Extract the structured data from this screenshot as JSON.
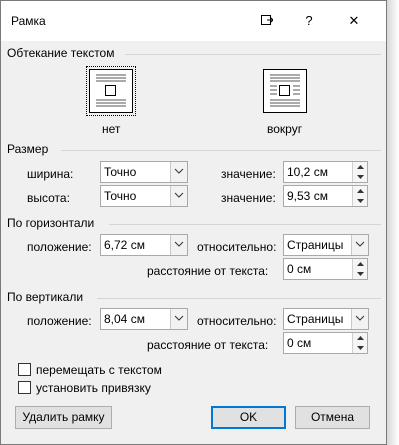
{
  "window": {
    "title": "Рамка",
    "help_glyph": "?",
    "close_glyph": "✕"
  },
  "wrap": {
    "heading": "Обтекание текстом",
    "none_label": "нет",
    "around_label": "вокруг"
  },
  "size": {
    "heading": "Размер",
    "width_label": "ширина:",
    "width_mode": "Точно",
    "width_value_label": "значение:",
    "width_value": "10,2 см",
    "height_label": "высота:",
    "height_mode": "Точно",
    "height_value_label": "значение:",
    "height_value": "9,53 см"
  },
  "horizontal": {
    "heading": "По горизонтали",
    "position_label": "положение:",
    "position_value": "6,72 см",
    "relative_label": "относительно:",
    "relative_value": "Страницы",
    "distance_label": "расстояние от текста:",
    "distance_value": "0 см"
  },
  "vertical": {
    "heading": "По вертикали",
    "position_label": "положение:",
    "position_value": "8,04 см",
    "relative_label": "относительно:",
    "relative_value": "Страницы",
    "distance_label": "расстояние от текста:",
    "distance_value": "0 см"
  },
  "options": {
    "move_with_text": "перемещать с текстом",
    "lock_anchor": "установить привязку"
  },
  "buttons": {
    "remove_frame": "Удалить рамку",
    "ok": "OK",
    "cancel": "Отмена"
  },
  "colors": {
    "accent": "#0078d7",
    "dialog_bg": "#f0f0f0"
  }
}
